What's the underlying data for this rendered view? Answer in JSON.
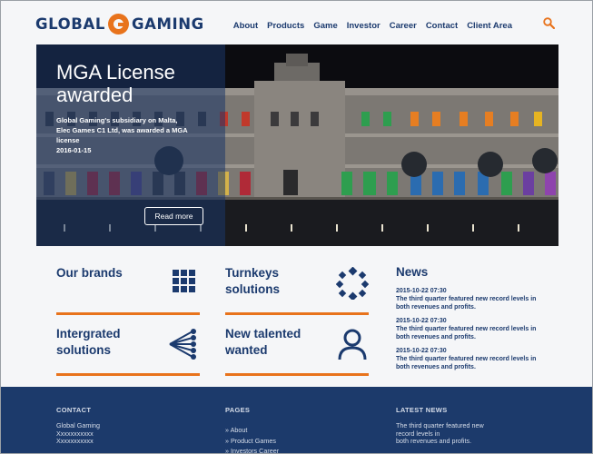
{
  "header": {
    "logo_left": "GLOBAL",
    "logo_right": "GAMING",
    "nav": [
      "About",
      "Products",
      "Game",
      "Investor",
      "Career",
      "Contact",
      "Client Area"
    ]
  },
  "hero": {
    "title": "MGA License awarded",
    "text": "Global Gaming's subsidiary on Malta, Elec Games C1 Ltd, was awarded a MGA license",
    "date": "2016-01-15",
    "button": "Read more"
  },
  "tiles": [
    {
      "title": "Our brands",
      "icon": "grid-icon"
    },
    {
      "title": "Turnkeys solutions",
      "icon": "ring-icon"
    },
    {
      "title": "Intergrated solutions",
      "icon": "fan-icon"
    },
    {
      "title": "New talented wanted",
      "icon": "person-icon"
    }
  ],
  "news": {
    "title": "News",
    "items": [
      {
        "date": "2015-10-22 07:30",
        "text": "The third quarter featured new record levels in both revenues and profits."
      },
      {
        "date": "2015-10-22 07:30",
        "text": "The third quarter featured new record levels in both revenues and profits."
      },
      {
        "date": "2015-10-22 07:30",
        "text": "The third quarter featured new record levels in both revenues and profits."
      }
    ]
  },
  "footer": {
    "contact_heading": "CONTACT",
    "contact_lines": [
      "Global Gaming",
      "Xxxxxxxxxxx",
      "Xxxxxxxxxxx"
    ],
    "pages_heading": "PAGES",
    "pages_links": [
      "» About",
      "» Product Games",
      "» Investors Career"
    ],
    "latest_heading": "LATEST NEWS",
    "latest_lines": [
      "The third quarter featured new",
      "record levels in",
      "both revenues and profits."
    ]
  },
  "colors": {
    "navy": "#1b3a6e",
    "orange": "#e8731c",
    "footer": "#1c3a6b",
    "background": "#f5f6f8"
  }
}
